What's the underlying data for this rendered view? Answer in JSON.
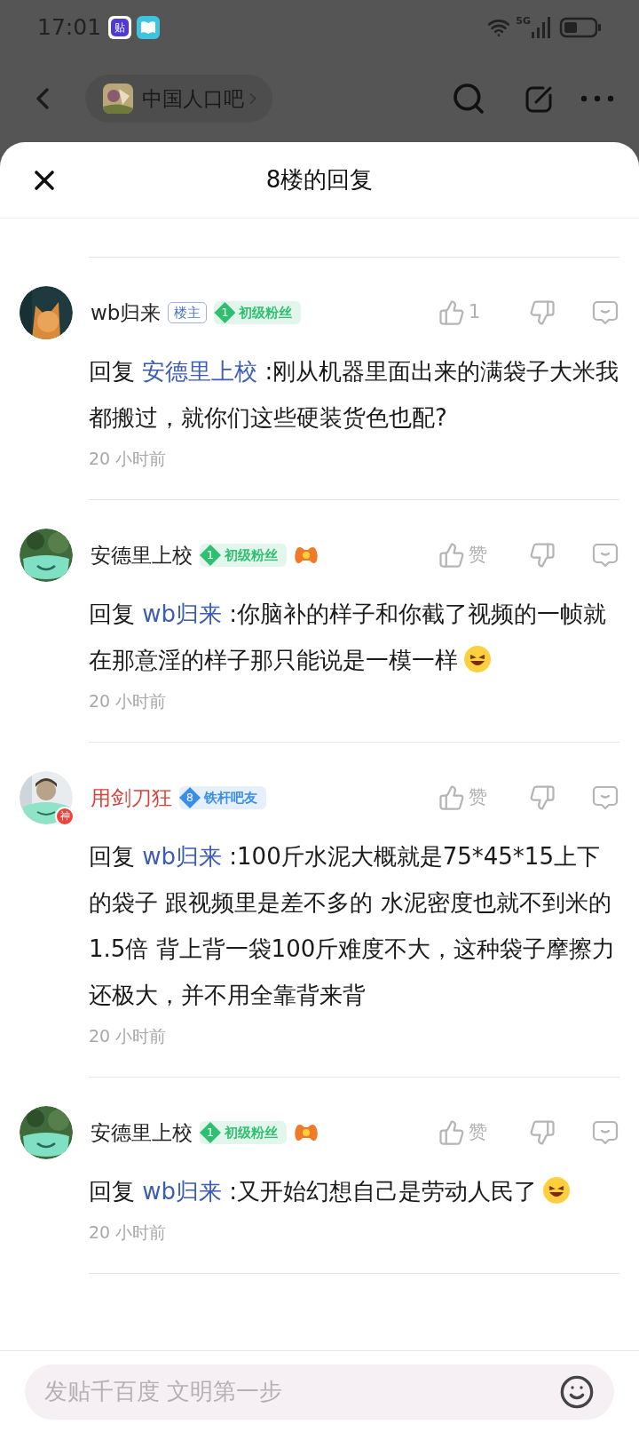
{
  "status_bar": {
    "time": "17:01",
    "app_icons": [
      {
        "kind": "tieba",
        "label": "贴"
      },
      {
        "kind": "book"
      }
    ],
    "network": "5G"
  },
  "nav_bar": {
    "forum": "中国人口吧"
  },
  "sheet": {
    "title": "8楼的回复"
  },
  "comments": [
    {
      "avatar": {
        "kind": "cat"
      },
      "user": {
        "name": "wb归来",
        "color": "#222222"
      },
      "host": true,
      "host_label": "楼主",
      "badge": {
        "level": "1",
        "title": "初级粉丝",
        "color": "#2fbf71"
      },
      "game_icon": false,
      "likes": "1",
      "reply_prefix": "回复",
      "reply_to": "安德里上校",
      "text": ":刚从机器里面出来的满袋子大米我都搬过，就你们这些硬装货色也配?",
      "emoji": false,
      "time": "20 小时前"
    },
    {
      "avatar": {
        "kind": "mask"
      },
      "user": {
        "name": "安德里上校",
        "color": "#222222"
      },
      "host": false,
      "badge": {
        "level": "1",
        "title": "初级粉丝",
        "color": "#2fbf71"
      },
      "game_icon": true,
      "likes": "赞",
      "reply_prefix": "回复",
      "reply_to": "wb归来",
      "text": ":你脑补的样子和你截了视频的一帧就在那意淫的样子那只能说是一模一样",
      "emoji": true,
      "time": "20 小时前"
    },
    {
      "avatar": {
        "kind": "person"
      },
      "user": {
        "name": "用剑刀狂",
        "color": "#d8403a"
      },
      "host": false,
      "badge": {
        "level": "8",
        "title": "铁杆吧友",
        "color": "#3a8ee6"
      },
      "game_icon": false,
      "god_mark": "神",
      "likes": "赞",
      "reply_prefix": "回复",
      "reply_to": "wb归来",
      "text": ":100斤水泥大概就是75*45*15上下的袋子 跟视频里是差不多的 水泥密度也就不到米的1.5倍 背上背一袋100斤难度不大，这种袋子摩擦力还极大，并不用全靠背来背",
      "emoji": false,
      "time": "20 小时前"
    },
    {
      "avatar": {
        "kind": "mask"
      },
      "user": {
        "name": "安德里上校",
        "color": "#222222"
      },
      "host": false,
      "badge": {
        "level": "1",
        "title": "初级粉丝",
        "color": "#2fbf71"
      },
      "game_icon": true,
      "likes": "赞",
      "reply_prefix": "回复",
      "reply_to": "wb归来",
      "text": ":又开始幻想自己是劳动人民了",
      "emoji": true,
      "time": "20 小时前"
    }
  ],
  "composer": {
    "placeholder": "发贴千百度 文明第一步"
  }
}
